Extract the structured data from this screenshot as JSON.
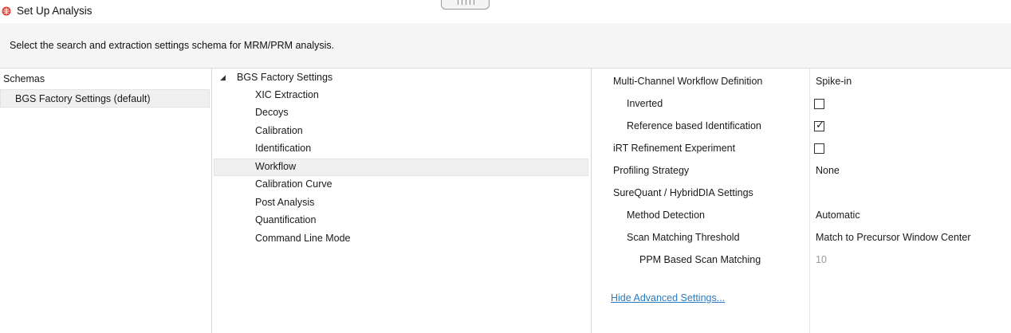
{
  "window": {
    "title": "Set Up Analysis"
  },
  "instruction": "Select the search and extraction settings schema for MRM/PRM analysis.",
  "schemas": {
    "header": "Schemas",
    "items": [
      "BGS Factory Settings (default)"
    ]
  },
  "tree": {
    "root": "BGS Factory Settings",
    "children": [
      "XIC Extraction",
      "Decoys",
      "Calibration",
      "Identification",
      "Workflow",
      "Calibration Curve",
      "Post Analysis",
      "Quantification",
      "Command Line Mode"
    ],
    "selected": "Workflow"
  },
  "settings": {
    "multi_channel_label": "Multi-Channel Workflow Definition",
    "multi_channel_value": "Spike-in",
    "inverted_label": "Inverted",
    "inverted_checked": false,
    "reference_label": "Reference based Identification",
    "reference_checked": true,
    "irt_label": "iRT Refinement Experiment",
    "irt_checked": false,
    "profiling_label": "Profiling Strategy",
    "profiling_value": "None",
    "surequant_label": "SureQuant / HybridDIA Settings",
    "method_detection_label": "Method Detection",
    "method_detection_value": "Automatic",
    "scan_matching_label": "Scan Matching Threshold",
    "scan_matching_value": "Match to Precursor Window Center",
    "ppm_label": "PPM Based Scan Matching",
    "ppm_value": "10"
  },
  "hide_advanced": "Hide Advanced Settings..."
}
